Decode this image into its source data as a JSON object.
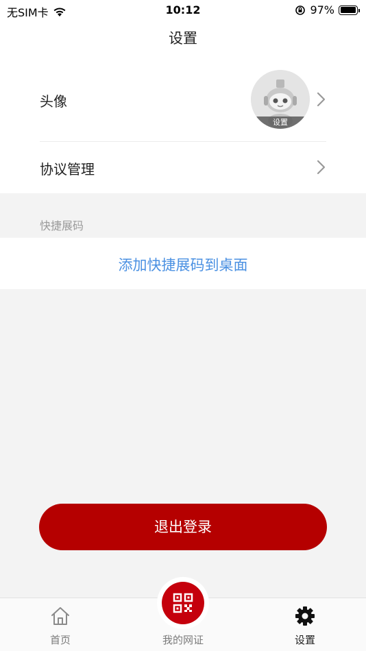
{
  "status_bar": {
    "carrier": "无SIM卡",
    "time": "10:12",
    "battery_percent": "97%",
    "battery_level": 0.97
  },
  "nav": {
    "title": "设置"
  },
  "settings": {
    "avatar_label": "头像",
    "avatar_caption": "设置",
    "agreement_label": "协议管理"
  },
  "shortcut": {
    "section_title": "快捷展码",
    "add_link": "添加快捷展码到桌面"
  },
  "logout": {
    "label": "退出登录"
  },
  "tabs": [
    {
      "label": "首页",
      "icon": "home-icon"
    },
    {
      "label": "我的网证",
      "icon": "qr-code-icon"
    },
    {
      "label": "设置",
      "icon": "gear-icon"
    }
  ],
  "colors": {
    "brand_red": "#b50000",
    "link_blue": "#4a90e2",
    "background": "#f3f3f3"
  }
}
